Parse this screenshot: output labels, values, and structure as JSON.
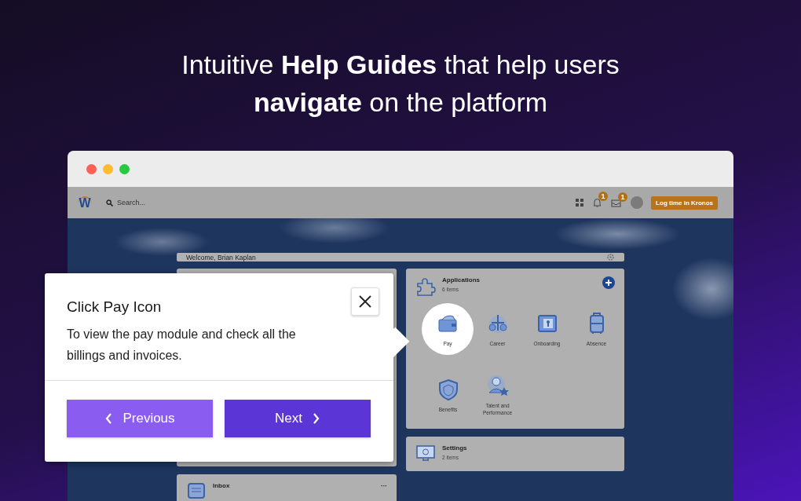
{
  "headline": "Intuitive **Help Guides** that help users **navigate** on the platform",
  "topbar": {
    "logo": "W",
    "search": {
      "placeholder": "Search..."
    },
    "notifications_badge": "1",
    "inbox_badge": "1",
    "action_button": "Log time in Kronos"
  },
  "welcome": {
    "text": "Welcome, Brian Kaplan"
  },
  "applications": {
    "title": "Applications",
    "count": "6 items",
    "apps": [
      {
        "label": "Pay",
        "highlighted": true
      },
      {
        "label": "Career",
        "highlighted": false
      },
      {
        "label": "Onboarding",
        "highlighted": false
      },
      {
        "label": "Absence",
        "highlighted": false
      },
      {
        "label": "Benefits",
        "highlighted": false
      },
      {
        "label": "Talent and Performance",
        "highlighted": false
      }
    ]
  },
  "settings": {
    "title": "Settings",
    "count": "2 items"
  },
  "inbox": {
    "title": "Inbox",
    "more": "···"
  },
  "guide": {
    "title": "Click Pay Icon",
    "body": "To view the pay module and check all the billings and invoices.",
    "buttons": [
      {
        "label": "Previous",
        "kind": "previous"
      },
      {
        "label": "Next",
        "kind": "next"
      }
    ]
  }
}
